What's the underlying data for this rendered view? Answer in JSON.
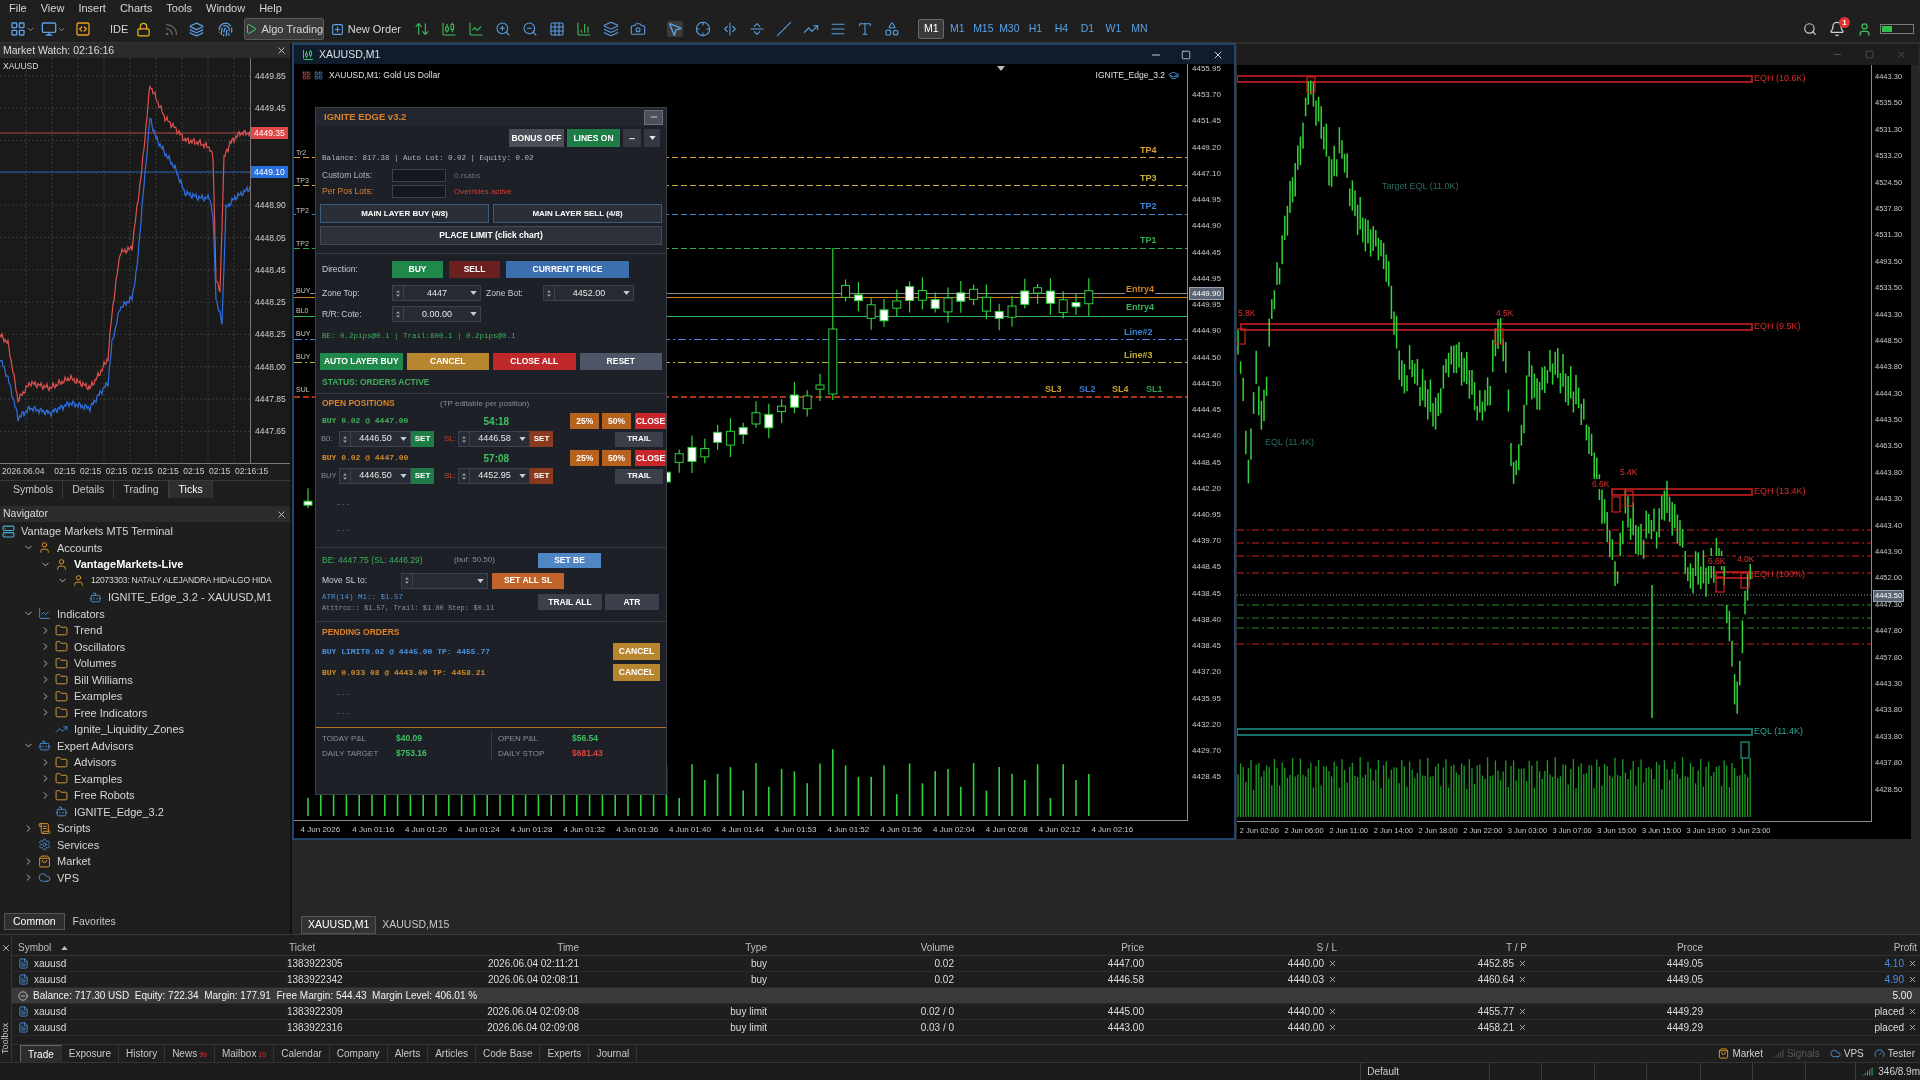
{
  "menu": [
    "File",
    "View",
    "Insert",
    "Charts",
    "Tools",
    "Window",
    "Help"
  ],
  "toolbar": {
    "ide": "IDE",
    "algo_trading": {
      "label": "Algo Trading",
      "on": true
    },
    "new_order": "New Order",
    "timeframes": [
      {
        "label": "M1",
        "selected": true
      },
      {
        "label": "M1",
        "selected": false
      },
      {
        "label": "M15",
        "selected": false
      },
      {
        "label": "M30",
        "selected": false
      },
      {
        "label": "H1",
        "selected": false
      },
      {
        "label": "H4",
        "selected": false
      },
      {
        "label": "D1",
        "selected": false
      },
      {
        "label": "W1",
        "selected": false
      },
      {
        "label": "MN",
        "selected": false
      }
    ],
    "notification_count": "1"
  },
  "market_watch": {
    "title": "Market Watch: 02:16:16",
    "symbol": "XAUUSD",
    "price_labels": [
      "4449.85",
      "4449.45",
      "4448.90",
      "4448.05",
      "4448.45",
      "4448.25",
      "4448.25",
      "4448.00",
      "4447.85",
      "4447.65"
    ],
    "ask_tag": "4449.35",
    "bid_tag": "4449.10",
    "time_labels": [
      "2026.06.04",
      "02:15",
      "02:15",
      "02:15",
      "02:15",
      "02:15",
      "02:15",
      "02:15",
      "02:16:15"
    ],
    "tabs": [
      {
        "label": "Symbols",
        "selected": false
      },
      {
        "label": "Details",
        "selected": false
      },
      {
        "label": "Trading",
        "selected": false
      },
      {
        "label": "Ticks",
        "selected": true
      }
    ]
  },
  "navigator": {
    "title": "Navigator",
    "root": "Vantage Markets MT5 Terminal",
    "items": [
      {
        "label": "Accounts",
        "kind": "accounts",
        "expanded": true,
        "children": [
          {
            "label": "VantageMarkets-Live",
            "kind": "server",
            "expanded": true,
            "current": true,
            "children": [
              {
                "label": "12073303: NATALY ALEJANDRA HIDALGO HIDA",
                "kind": "account",
                "expanded": true,
                "children": [
                  {
                    "label": "IGNITE_Edge_3.2 - XAUUSD,M1",
                    "kind": "expert"
                  }
                ]
              }
            ]
          }
        ]
      },
      {
        "label": "Indicators",
        "kind": "indicators",
        "expanded": true,
        "children": [
          {
            "label": "Trend",
            "kind": "folder",
            "expanded": false
          },
          {
            "label": "Oscillators",
            "kind": "folder",
            "expanded": false
          },
          {
            "label": "Volumes",
            "kind": "folder",
            "expanded": false
          },
          {
            "label": "Bill Williams",
            "kind": "folder",
            "expanded": false
          },
          {
            "label": "Examples",
            "kind": "folder",
            "expanded": false
          },
          {
            "label": "Free Indicators",
            "kind": "folder",
            "expanded": false
          },
          {
            "label": "Ignite_Liquidity_Zones",
            "kind": "indicator"
          }
        ]
      },
      {
        "label": "Expert Advisors",
        "kind": "experts",
        "expanded": true,
        "children": [
          {
            "label": "Advisors",
            "kind": "folder",
            "expanded": false
          },
          {
            "label": "Examples",
            "kind": "folder",
            "expanded": false
          },
          {
            "label": "Free Robots",
            "kind": "folder",
            "expanded": false
          },
          {
            "label": "IGNITE_Edge_3.2",
            "kind": "expert"
          }
        ]
      },
      {
        "label": "Scripts",
        "kind": "scripts",
        "expanded": false
      },
      {
        "label": "Services",
        "kind": "services"
      },
      {
        "label": "Market",
        "kind": "market",
        "expanded": false
      },
      {
        "label": "VPS",
        "kind": "vps",
        "expanded": false
      }
    ]
  },
  "navigator_tabs": [
    {
      "label": "Common",
      "selected": true
    },
    {
      "label": "Favorites",
      "selected": false
    }
  ],
  "chart_m1": {
    "window_title": "XAUUSD,M1",
    "header": "XAUUSD,M1: Gold US Dollar",
    "expert_label": "IGNITE_Edge_3.2",
    "price_labels": [
      "4455.95",
      "4453.70",
      "4451.45",
      "4449.20",
      "4447.10",
      "4444.95",
      "4444.90",
      "4444.45",
      "4444.95",
      "4449.95",
      "4444.90",
      "4444.50",
      "4444.50",
      "4444.45",
      "4443.40",
      "4448.45",
      "4442.20",
      "4440.95",
      "4439.70",
      "4448.45",
      "4438.45",
      "4438.40",
      "4438.45",
      "4437.20",
      "4435.95",
      "4432.20",
      "4429.70",
      "4428.45"
    ],
    "price_tag": "4449.90",
    "time_labels": [
      "4 Jun 2026",
      "4 Jun 01:16",
      "4 Jun 01:20",
      "4 Jun 01:24",
      "4 Jun 01:28",
      "4 Jun 01:32",
      "4 Jun 01:36",
      "4 Jun 01:40",
      "4 Jun 01:44",
      "4 Jun 01:53",
      "4 Jun 01:52",
      "4 Jun 01:56",
      "4 Jun 02:04",
      "4 Jun 02:08",
      "4 Jun 02:12",
      "4 Jun 02:16"
    ],
    "edge_labels": [
      "Tr2",
      "TP3",
      "TP2",
      "TP2",
      "BUY",
      "BL0",
      "BUY",
      "BUY",
      "SUL"
    ],
    "level_lines": [
      {
        "label": "TP4",
        "color": "#d9a038"
      },
      {
        "label": "TP3",
        "color": "#c9b03a"
      },
      {
        "label": "TP2",
        "color": "#3a86d6"
      },
      {
        "label": "TP1",
        "color": "#33a852"
      },
      {
        "label": "Entry4",
        "color": "#d08424"
      },
      {
        "label": "Entry4",
        "color": "#33b85a"
      },
      {
        "label": "Line#2",
        "color": "#3a86d6"
      },
      {
        "label": "Line#3",
        "color": "#c2b030"
      }
    ],
    "sl_labels": [
      {
        "label": "SL3",
        "color": "#c9a030"
      },
      {
        "label": "SL2",
        "color": "#3a78cc"
      },
      {
        "label": "SL4",
        "color": "#c9a030"
      },
      {
        "label": "SL1",
        "color": "#2f9e4e"
      }
    ]
  },
  "panel": {
    "title": "IGNITE EDGE v3.2",
    "top_buttons": [
      {
        "label": "BONUS OFF",
        "color": "#4a4d55"
      },
      {
        "label": "LINES ON",
        "color": "#1e7c46"
      },
      {
        "label": "--",
        "color": "#343842"
      }
    ],
    "stats": "Balance: 817.38 | Auto Lot: 0.02 | Equity: 0.02",
    "custom_lots": {
      "label": "Custom Lots:",
      "note": "0.rsabs"
    },
    "per_pos_lots": {
      "label": "Per Pos Lots:",
      "note": "Overrides active"
    },
    "layer_buttons": [
      "MAIN LAYER BUY (4/8)",
      "MAIN LAYER SELL (4/8)"
    ],
    "place_limit": "PLACE LIMIT (click chart)",
    "direction": {
      "label": "Direction:",
      "options": [
        {
          "label": "BUY",
          "color": "#21884b"
        },
        {
          "label": "SELL",
          "color": "#6b1f1f"
        },
        {
          "label": "CURRENT PRICE",
          "color": "#3d6fae"
        }
      ]
    },
    "zone_top": {
      "label": "Zone Top:",
      "value": "4447"
    },
    "zone_bot": {
      "label": "Zone Bot:",
      "value": "4452.00"
    },
    "rr": {
      "label": "R/R: Cote:",
      "value": "0.00.00"
    },
    "be_info": "BE: 0.2pips@0.1 | Trail:800.1 | 0.2pips@0.1",
    "actions": [
      {
        "label": "AUTO LAYER BUY",
        "color": "#21884b"
      },
      {
        "label": "CANCEL",
        "color": "#b8862f"
      },
      {
        "label": "CLOSE ALL",
        "color": "#c0292b"
      },
      {
        "label": "RESET",
        "color": "#4d5566"
      }
    ],
    "status": "STATUS: ORDERS ACTIVE",
    "open_positions": {
      "title": "OPEN POSITIONS",
      "hint": "(TP editable per position)",
      "items": [
        {
          "text": "BUY 0.02 @ 4447.00",
          "color": "#3fae5a",
          "timer": "54:18",
          "buttons": [
            {
              "label": "25%",
              "kind": "partial"
            },
            {
              "label": "50%",
              "kind": "partial"
            },
            {
              "label": "CLOSE",
              "kind": "close"
            }
          ],
          "tp_label": "B0:",
          "tp": "4446.50",
          "set_tp": "SET",
          "sl_label": "SL:",
          "sl": "4446.58",
          "set_sl": "SET",
          "trail": "TRAIL"
        },
        {
          "text": "BUY 0.02 @ 4447.00",
          "color": "#d08a2a",
          "timer": "57:08",
          "buttons": [
            {
              "label": "25%",
              "kind": "partial"
            },
            {
              "label": "50%",
              "kind": "partial"
            },
            {
              "label": "CLOSE",
              "kind": "close"
            }
          ],
          "tp_label": "BUY",
          "tp": "4446.50",
          "set_tp": "SET",
          "sl_label": "SL:",
          "sl": "4452.95",
          "set_sl": "SET",
          "trail": "TRAIL"
        }
      ],
      "empty_slots": [
        "---",
        "---"
      ]
    },
    "be_row": {
      "text": "BE: 4447.75 (SL: 4446.29)",
      "buffer": "(buf: 50.50)",
      "button": "SET BE"
    },
    "move_sl": {
      "label": "Move SL to:",
      "button": "SET ALL SL"
    },
    "atr": {
      "title": "ATR(14) M1:: $1.57",
      "detail": "Atttrcc:: $1.57, Trail: $1.80  Step: $0.11",
      "buttons": [
        "TRAIL ALL",
        "ATR"
      ]
    },
    "pending": {
      "title": "PENDING ORDERS",
      "items": [
        {
          "text": "BUY LIMIT0.02 @ 4445.00  TP: 4455.77",
          "color": "#4a90d9",
          "button": "CANCEL"
        },
        {
          "text": "BUY 0.033 08 @ 4443.00  TP: 4458.21",
          "color": "#d08a2a",
          "button": "CANCEL"
        }
      ],
      "empty_slots": [
        "---",
        "---"
      ]
    },
    "footer": [
      {
        "label": "TODAY P&L",
        "value": "$40.09",
        "kind": "gain"
      },
      {
        "label": "OPEN P&L",
        "value": "$56.54",
        "kind": "gain"
      },
      {
        "label": "DAILY TARGET",
        "value": "$753.16",
        "kind": "gain"
      },
      {
        "label": "DAILY STOP",
        "value": "$681.43",
        "kind": "loss"
      }
    ]
  },
  "chart_m15": {
    "price_labels": [
      "4443.30",
      "4535.50",
      "4531.30",
      "4533.20",
      "4524.50",
      "4537.80",
      "4531.30",
      "4493.50",
      "4533.50",
      "4443.30",
      "4448.50",
      "4443.80",
      "4444.30",
      "4443.50",
      "4463.50",
      "4443.80",
      "4443.30",
      "4443.40",
      "4443.90",
      "4452.00",
      "4447.30",
      "4447.80",
      "4457.80",
      "4443.30",
      "4433.80",
      "4433.80",
      "4437.80",
      "4428.50"
    ],
    "price_tag": "4443.50",
    "time_labels": [
      "2 Jun 02:00",
      "2 Jun 06:00",
      "2 Jun 11:00",
      "2 Jun 14:00",
      "2 Jun 18:00",
      "2 Jun 22:00",
      "3 Jun 03:00",
      "3 Jun 07:00",
      "3 Jun 15:00",
      "3 Jun 15:00",
      "3 Jun 19:00",
      "3 Jun 23:00"
    ],
    "zones": [
      {
        "label": "EQH (10.6K)",
        "kind": "high"
      },
      {
        "label": "EQH (9.5K)",
        "kind": "high"
      },
      {
        "label": "EQH (13.4K)",
        "kind": "high"
      },
      {
        "label": "EQH (100%)",
        "kind": "high"
      },
      {
        "label": "EQL (11.4K)",
        "kind": "low"
      }
    ],
    "counts": [
      "5.8K",
      "4.5K",
      "6.6K",
      "5.4K",
      "6.6K",
      "4.0K"
    ],
    "faint_labels": [
      "Target EQL (11.0K)",
      "EQL (11.4K)"
    ]
  },
  "chart_tabs": [
    {
      "label": "XAUUSD,M1",
      "selected": true
    },
    {
      "label": "XAUUSD,M15",
      "selected": false
    }
  ],
  "trade_table": {
    "columns": [
      "Symbol",
      "Ticket",
      "Time",
      "Type",
      "Volume",
      "Price",
      "S / L",
      "T / P",
      "Proce",
      "Profit"
    ],
    "positions": [
      {
        "symbol": "xauusd",
        "ticket": "1383922305",
        "time": "2026.06.04 02:11:21",
        "type": "buy",
        "volume": "0.02",
        "price": "4447.00",
        "sl": "4440.00",
        "tp": "4452.85",
        "current": "4449.05",
        "profit": "4.10"
      },
      {
        "symbol": "xauusd",
        "ticket": "1383922342",
        "time": "2026.06.04 02:08:11",
        "type": "buy",
        "volume": "0.02",
        "price": "4446.58",
        "sl": "4440.03",
        "tp": "4460.64",
        "current": "4449.05",
        "profit": "4.90"
      }
    ],
    "summary": {
      "text": "Balance: 717.30 USD  Equity: 722.34  Margin: 177.91  Free Margin: 544.43  Margin Level: 406.01 %",
      "profit": "5.00"
    },
    "orders": [
      {
        "symbol": "xauusd",
        "ticket": "1383922309",
        "time": "2026.06.04 02:09:08",
        "type": "buy limit",
        "volume": "0.02 / 0",
        "price": "4445.00",
        "sl": "4440.00",
        "tp": "4455.77",
        "current": "4449.29",
        "profit": "placed"
      },
      {
        "symbol": "xauusd",
        "ticket": "1383922316",
        "time": "2026.06.04 02:09:08",
        "type": "buy limit",
        "volume": "0.03 / 0",
        "price": "4443.00",
        "sl": "4440.00",
        "tp": "4458.21",
        "current": "4449.29",
        "profit": "placed"
      }
    ]
  },
  "toolbox": {
    "label": "Toolbox",
    "tabs": [
      {
        "label": "Trade",
        "selected": true
      },
      {
        "label": "Exposure",
        "selected": false
      },
      {
        "label": "History",
        "selected": false
      },
      {
        "label": "News",
        "selected": false,
        "badge": "99"
      },
      {
        "label": "Mailbox",
        "selected": false,
        "badge": "10"
      },
      {
        "label": "Calendar",
        "selected": false
      },
      {
        "label": "Company",
        "selected": false
      },
      {
        "label": "Alerts",
        "selected": false
      },
      {
        "label": "Articles",
        "selected": false
      },
      {
        "label": "Code Base",
        "selected": false
      },
      {
        "label": "Experts",
        "selected": false
      },
      {
        "label": "Journal",
        "selected": false
      }
    ],
    "services": [
      {
        "label": "Market",
        "kind": "market",
        "disabled": false
      },
      {
        "label": "Signals",
        "kind": "signals",
        "disabled": true
      },
      {
        "label": "VPS",
        "kind": "vps",
        "disabled": false
      },
      {
        "label": "Tester",
        "kind": "tester",
        "disabled": false
      }
    ]
  },
  "status_bar": {
    "profile": "Default",
    "connection": "346/8.9m"
  }
}
